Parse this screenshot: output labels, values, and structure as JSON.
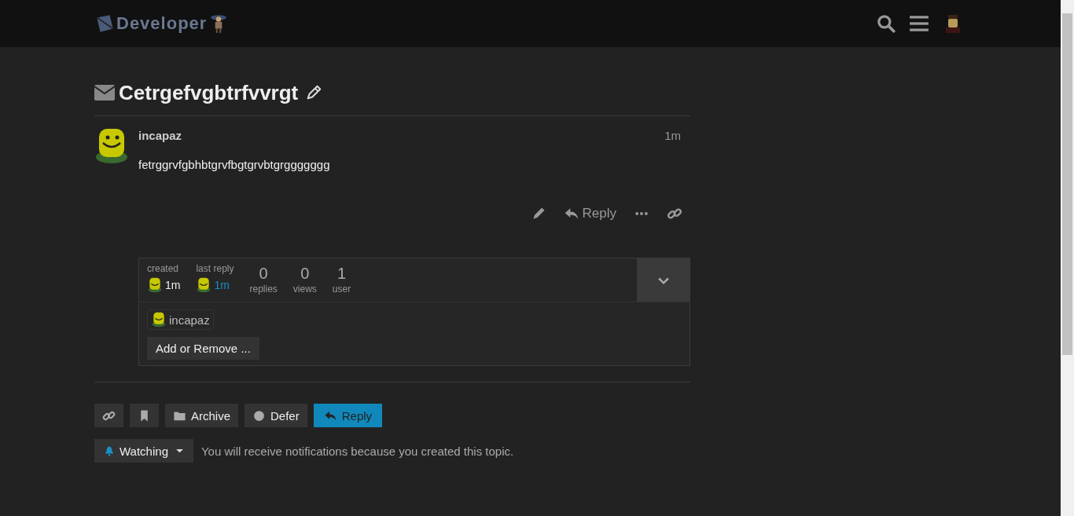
{
  "header": {
    "logo": "Developer"
  },
  "topic": {
    "title": "Cetrgefvgbtrfvvrgt",
    "private": true
  },
  "post": {
    "username": "incapaz",
    "age": "1m",
    "body": "fetrggrvfgbhbtgrvfbgtgrvbtgrggggggg",
    "actions": {
      "reply": "Reply"
    }
  },
  "summary": {
    "created": {
      "label": "created",
      "age": "1m"
    },
    "last_reply": {
      "label": "last reply",
      "age": "1m"
    },
    "stats": [
      {
        "value": "0",
        "label": "replies"
      },
      {
        "value": "0",
        "label": "views"
      },
      {
        "value": "1",
        "label": "user"
      }
    ],
    "participants": [
      "incapaz"
    ],
    "add_remove": "Add or Remove ..."
  },
  "footer_buttons": [
    {
      "kind": "link"
    },
    {
      "kind": "bookmark"
    },
    {
      "kind": "archive",
      "label": "Archive"
    },
    {
      "kind": "defer",
      "label": "Defer"
    },
    {
      "kind": "reply",
      "label": "Reply"
    }
  ],
  "notifications": {
    "level": "Watching",
    "reason": "You will receive notifications because you created this topic."
  }
}
